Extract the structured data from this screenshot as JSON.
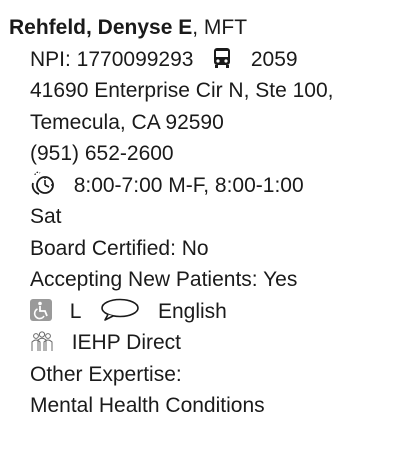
{
  "provider": {
    "name": "Rehfeld, Denyse E",
    "credential": ", MFT"
  },
  "npi_label": "NPI: 1770099293",
  "bus_route": "2059",
  "address": {
    "line1": "41690 Enterprise Cir N, Ste 100,",
    "line2": "Temecula, CA 92590"
  },
  "phone": "(951) 652-2600",
  "hours": {
    "line1": "8:00-7:00 M-F, 8:00-1:00",
    "line2": "Sat"
  },
  "board_certified": "Board Certified: No",
  "accepting_new_patients": "Accepting New Patients: Yes",
  "accessibility_level": "L",
  "language": "English",
  "network": "IEHP Direct",
  "other_expertise_label": "Other Expertise:",
  "other_expertise_value": "Mental Health Conditions",
  "icons": {
    "bus": "bus-icon",
    "clock": "clock-icon",
    "accessibility": "wheelchair-icon",
    "language": "speech-bubble-icon",
    "network": "group-icon"
  },
  "colors": {
    "text": "#1a1a1a",
    "icon_gray": "#9a9a9a"
  }
}
